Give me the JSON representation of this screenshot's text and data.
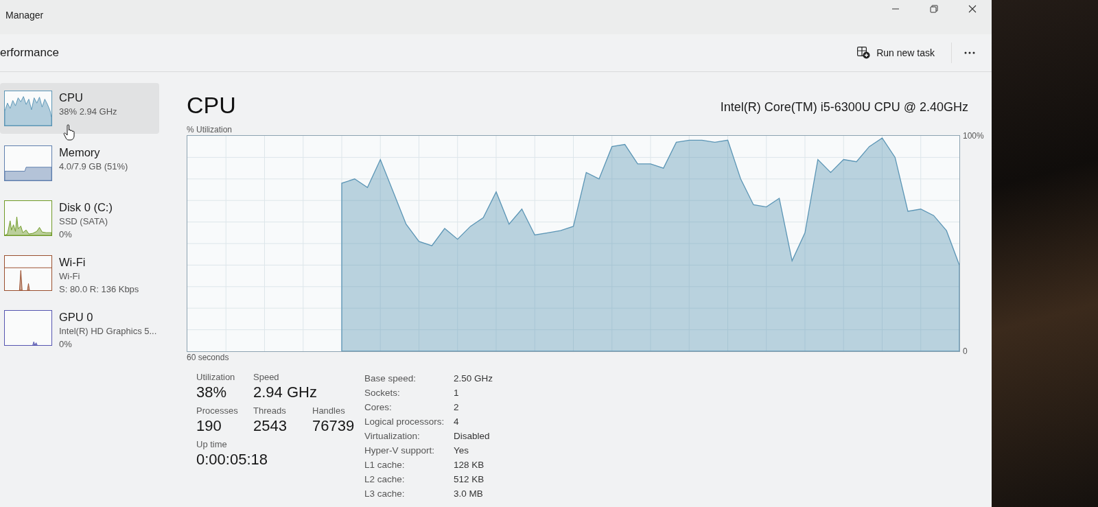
{
  "window": {
    "title": "Manager"
  },
  "header": {
    "title": "erformance",
    "run_task": {
      "label": "Run new task"
    }
  },
  "sidebar": {
    "items": [
      {
        "kind": "cpu",
        "name": "CPU",
        "details": [
          "38% 2.94 GHz"
        ],
        "selected": true,
        "color": "#5b95b5"
      },
      {
        "kind": "memory",
        "name": "Memory",
        "details": [
          "4.0/7.9 GB (51%)"
        ],
        "selected": false,
        "color": "#5f7fae"
      },
      {
        "kind": "disk",
        "name": "Disk 0 (C:)",
        "details": [
          "SSD (SATA)",
          "0%"
        ],
        "selected": false,
        "color": "#6f9a25"
      },
      {
        "kind": "network",
        "name": "Wi-Fi",
        "details": [
          "Wi-Fi",
          "S: 80.0 R: 136 Kbps"
        ],
        "selected": false,
        "color": "#9a4f2e"
      },
      {
        "kind": "gpu",
        "name": "GPU 0",
        "details": [
          "Intel(R) HD Graphics 5...",
          "0%"
        ],
        "selected": false,
        "color": "#5555b0"
      }
    ]
  },
  "detail": {
    "title": "CPU",
    "processor": "Intel(R) Core(TM) i5-6300U CPU @ 2.40GHz",
    "chart_data": {
      "type": "area",
      "ylabel": "% Utilization",
      "grid": true,
      "series": [
        {
          "color": "#5b95b5",
          "values": [
            null,
            null,
            null,
            null,
            null,
            null,
            null,
            null,
            null,
            null,
            null,
            null,
            78,
            80,
            76,
            89,
            74,
            59,
            51,
            49,
            57,
            52,
            58,
            62,
            74,
            59,
            66,
            54,
            55,
            56,
            58,
            83,
            80,
            95,
            96,
            87,
            87,
            85,
            97,
            98,
            98,
            97,
            98,
            80,
            68,
            67,
            71,
            42,
            55,
            89,
            83,
            89,
            88,
            95,
            99,
            90,
            65,
            66,
            63,
            56,
            40
          ]
        }
      ],
      "ylim": [
        0,
        100
      ],
      "yticks": [
        {
          "value": 0,
          "label": "0"
        },
        {
          "value": 100,
          "label": "100%"
        }
      ],
      "annotations": [
        {
          "text": "60 seconds"
        }
      ]
    },
    "stat_rows": [
      [
        {
          "label": "Utilization",
          "value": "38%"
        },
        {
          "label": "Speed",
          "value": "2.94 GHz"
        }
      ],
      [
        {
          "label": "Processes",
          "value": "190"
        },
        {
          "label": "Threads",
          "value": "2543"
        },
        {
          "label": "Handles",
          "value": "76739"
        }
      ],
      [
        {
          "label": "Up time",
          "value": "0:00:05:18"
        }
      ]
    ],
    "specs": [
      {
        "label": "Base speed:",
        "value": "2.50 GHz"
      },
      {
        "label": "Sockets:",
        "value": "1"
      },
      {
        "label": "Cores:",
        "value": "2"
      },
      {
        "label": "Logical processors:",
        "value": "4"
      },
      {
        "label": "Virtualization:",
        "value": "Disabled"
      },
      {
        "label": "Hyper-V support:",
        "value": "Yes"
      },
      {
        "label": "L1 cache:",
        "value": "128 KB"
      },
      {
        "label": "L2 cache:",
        "value": "512 KB"
      },
      {
        "label": "L3 cache:",
        "value": "3.0 MB"
      }
    ]
  }
}
